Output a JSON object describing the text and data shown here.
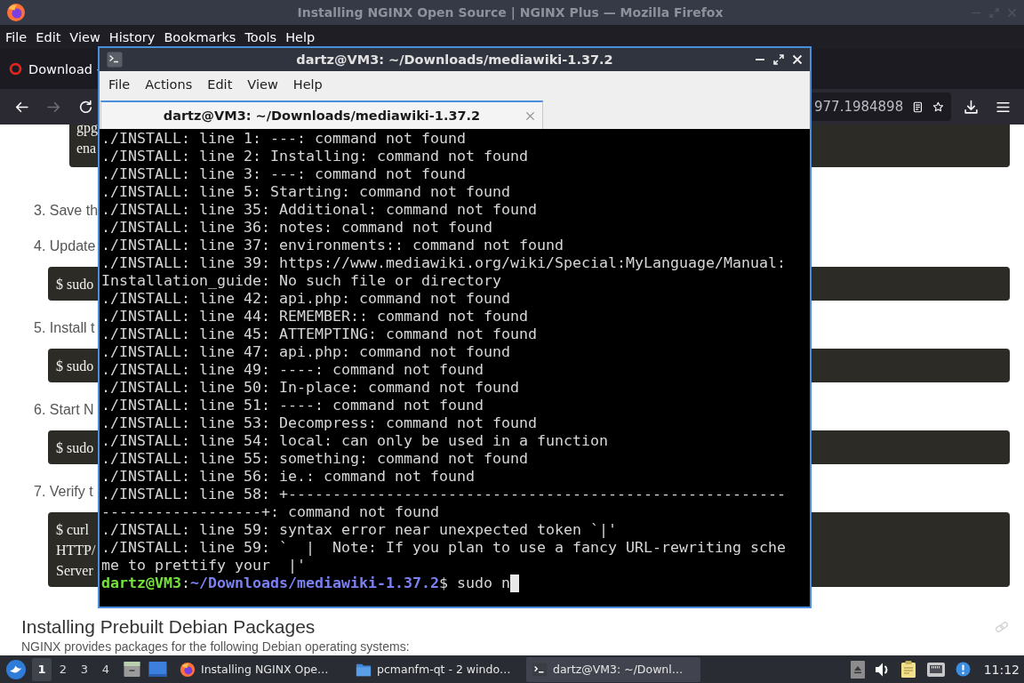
{
  "firefox": {
    "title": "Installing NGINX Open Source | NGINX Plus — Mozilla Firefox",
    "menu": [
      "File",
      "Edit",
      "View",
      "History",
      "Bookmarks",
      "Tools",
      "Help"
    ],
    "tab": {
      "label": "Download -"
    },
    "nav": [
      {
        "kind": "back",
        "disabled": false
      },
      {
        "kind": "forward",
        "disabled": true
      },
      {
        "kind": "reload",
        "disabled": false
      }
    ],
    "address": "977.1984898",
    "page": {
      "blocks": [
        {
          "kind": "nested_code",
          "lines": [
            "gpg",
            "ena"
          ]
        },
        {
          "kind": "step",
          "text": "3. Save th"
        },
        {
          "kind": "step",
          "text": "4. Update"
        },
        {
          "kind": "code",
          "lines": [
            "$ sudo"
          ]
        },
        {
          "kind": "step",
          "text": "5. Install t"
        },
        {
          "kind": "code",
          "lines": [
            "$ sudo"
          ]
        },
        {
          "kind": "step",
          "text": "6. Start N"
        },
        {
          "kind": "code",
          "lines": [
            "$ sudo"
          ]
        },
        {
          "kind": "step",
          "text": "7. Verify t"
        },
        {
          "kind": "code",
          "lines": [
            "$ curl",
            "HTTP/",
            "Server"
          ]
        }
      ],
      "heading": "Installing Prebuilt Debian Packages",
      "intro": "NGINX provides packages for the following Debian operating systems:"
    }
  },
  "terminal": {
    "title": "dartz@VM3: ~/Downloads/mediawiki-1.37.2",
    "menu": [
      "File",
      "Actions",
      "Edit",
      "View",
      "Help"
    ],
    "tabs": [
      {
        "label": "dartz@VM3: ~/Downloads/mediawiki-1.37.2",
        "selected": true
      }
    ],
    "lines": [
      "./INSTALL: line 1: ---: command not found",
      "./INSTALL: line 2: Installing: command not found",
      "./INSTALL: line 3: ---: command not found",
      "./INSTALL: line 5: Starting: command not found",
      "./INSTALL: line 35: Additional: command not found",
      "./INSTALL: line 36: notes: command not found",
      "./INSTALL: line 37: environments:: command not found",
      "./INSTALL: line 39: https://www.mediawiki.org/wiki/Special:MyLanguage/Manual:Installation_guide: No such file or directory",
      "./INSTALL: line 42: api.php: command not found",
      "./INSTALL: line 44: REMEMBER:: command not found",
      "./INSTALL: line 45: ATTEMPTING: command not found",
      "./INSTALL: line 47: api.php: command not found",
      "./INSTALL: line 49: ----: command not found",
      "./INSTALL: line 50: In-place: command not found",
      "./INSTALL: line 51: ----: command not found",
      "./INSTALL: line 53: Decompress: command not found",
      "./INSTALL: line 54: local: can only be used in a function",
      "./INSTALL: line 55: something: command not found",
      "./INSTALL: line 56: ie.: command not found",
      "./INSTALL: line 58: +--------------------------------------------------------------------------+: command not found",
      "./INSTALL: line 59: syntax error near unexpected token `|'",
      "./INSTALL: line 59: `  |  Note: If you plan to use a fancy URL-rewriting scheme to prettify your  |'"
    ],
    "prompt": {
      "user_host": "dartz@VM3",
      "separator": ":",
      "path": "~/Downloads/mediawiki-1.37.2",
      "symbol": "$"
    },
    "input": "sudo n",
    "cursor": true
  },
  "taskbar": {
    "workspaces": [
      {
        "label": "1",
        "selected": true
      },
      {
        "label": "2",
        "selected": false
      },
      {
        "label": "3",
        "selected": false
      },
      {
        "label": "4",
        "selected": false
      }
    ],
    "tasks": [
      {
        "kind": "browser",
        "label": "Installing NGINX Ope…",
        "selected": false
      },
      {
        "kind": "folder",
        "label": "pcmanfm-qt - 2 windo…",
        "selected": false
      },
      {
        "kind": "terminal",
        "label": "dartz@VM3: ~/Downl…",
        "selected": true
      }
    ],
    "clock": "11:12"
  }
}
